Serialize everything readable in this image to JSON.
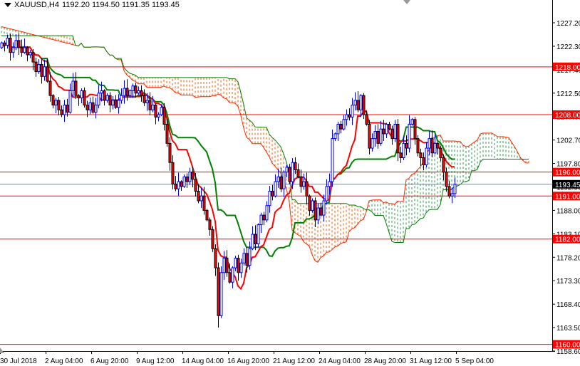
{
  "header": {
    "symbol": "XAUUSD,H4",
    "ohlc": "1192.20 1194.50 1191.35 1193.45"
  },
  "chart_data": {
    "type": "candlestick",
    "title": "XAUUSD,H4",
    "indicators": [
      "Ichimoku Kinko Hyo (9,26,52)"
    ],
    "ylim": [
      1158.6,
      1227.2
    ],
    "y_ticks": [
      "1227.20",
      "1222.30",
      "1217.40",
      "1212.50",
      "1207.60",
      "1202.70",
      "1197.80",
      "1192.90",
      "1188.00",
      "1183.10",
      "1178.20",
      "1173.30",
      "1168.40",
      "1163.50",
      "1158.60"
    ],
    "x_ticks": [
      "30 Jul 2018",
      "2 Aug 04:00",
      "6 Aug 20:00",
      "9 Aug 12:00",
      "14 Aug 04:00",
      "16 Aug 20:00",
      "21 Aug 12:00",
      "24 Aug 04:00",
      "28 Aug 20:00",
      "31 Aug 12:00",
      "5 Sep 04:00"
    ],
    "bars_per_x_tick": 16,
    "first_open": 1222.0,
    "closes": [
      1223,
      1222.5,
      1224,
      1221,
      1222,
      1223.5,
      1222,
      1221,
      1222,
      1220.5,
      1221,
      1219,
      1217,
      1218.5,
      1216,
      1218,
      1215,
      1212,
      1210,
      1211,
      1209,
      1208,
      1210,
      1208.5,
      1213,
      1215,
      1212,
      1211.5,
      1213,
      1210,
      1209,
      1210.5,
      1208.5,
      1210,
      1212.5,
      1213,
      1211,
      1212,
      1210,
      1211,
      1209.5,
      1211,
      1212,
      1213.5,
      1212,
      1213,
      1214,
      1212.5,
      1213,
      1212,
      1210.5,
      1211,
      1209,
      1210,
      1207.5,
      1208,
      1209.5,
      1206,
      1202,
      1198,
      1193.5,
      1192.5,
      1194,
      1193,
      1195,
      1194,
      1196,
      1194.5,
      1192,
      1190,
      1191,
      1188,
      1186,
      1184,
      1180,
      1176,
      1166,
      1175,
      1178,
      1175,
      1173,
      1176,
      1178,
      1175,
      1177,
      1179,
      1176.5,
      1180,
      1183,
      1181,
      1185,
      1187,
      1186,
      1189,
      1192,
      1191,
      1194,
      1195,
      1192.5,
      1196,
      1197,
      1194,
      1198,
      1196.5,
      1195,
      1193,
      1194,
      1191,
      1188,
      1190,
      1186,
      1188.5,
      1187,
      1190,
      1193,
      1194,
      1203,
      1204,
      1206,
      1205,
      1207,
      1208,
      1207.5,
      1210,
      1211,
      1209,
      1212,
      1208,
      1206,
      1201,
      1203,
      1204.5,
      1202,
      1205,
      1204,
      1206,
      1205,
      1203,
      1206,
      1200,
      1199,
      1202,
      1201,
      1206,
      1207,
      1203,
      1200,
      1199,
      1197.5,
      1201,
      1203,
      1200,
      1202,
      1201,
      1199,
      1196,
      1193,
      1191,
      1191.5,
      1193.45
    ],
    "extreme_low": {
      "index": 76,
      "value": 1163.5
    },
    "horizontal_levels": [
      {
        "price": 1218.0,
        "label": "1218.00"
      },
      {
        "price": 1208.0,
        "label": "1208.00"
      },
      {
        "price": 1196.0,
        "label": "1196.00"
      },
      {
        "price": 1191.0,
        "label": "1191.00"
      },
      {
        "price": 1182.0,
        "label": "1182.00"
      },
      {
        "price": 1160.0,
        "label": "1160.00"
      }
    ],
    "bid": {
      "price": 1193.45,
      "label": "1193.45"
    },
    "colors": {
      "level": "#ff0000",
      "bid": "#778899",
      "bull": "#0000ff",
      "bear_body": "#ff0000",
      "tenkan": "#ff0000",
      "kijun": "#008000",
      "span_a": "#ff2a00",
      "span_b": "#008000",
      "cloud_bear": "#ff5a00",
      "cloud_bull": "#2e9a4e"
    }
  }
}
